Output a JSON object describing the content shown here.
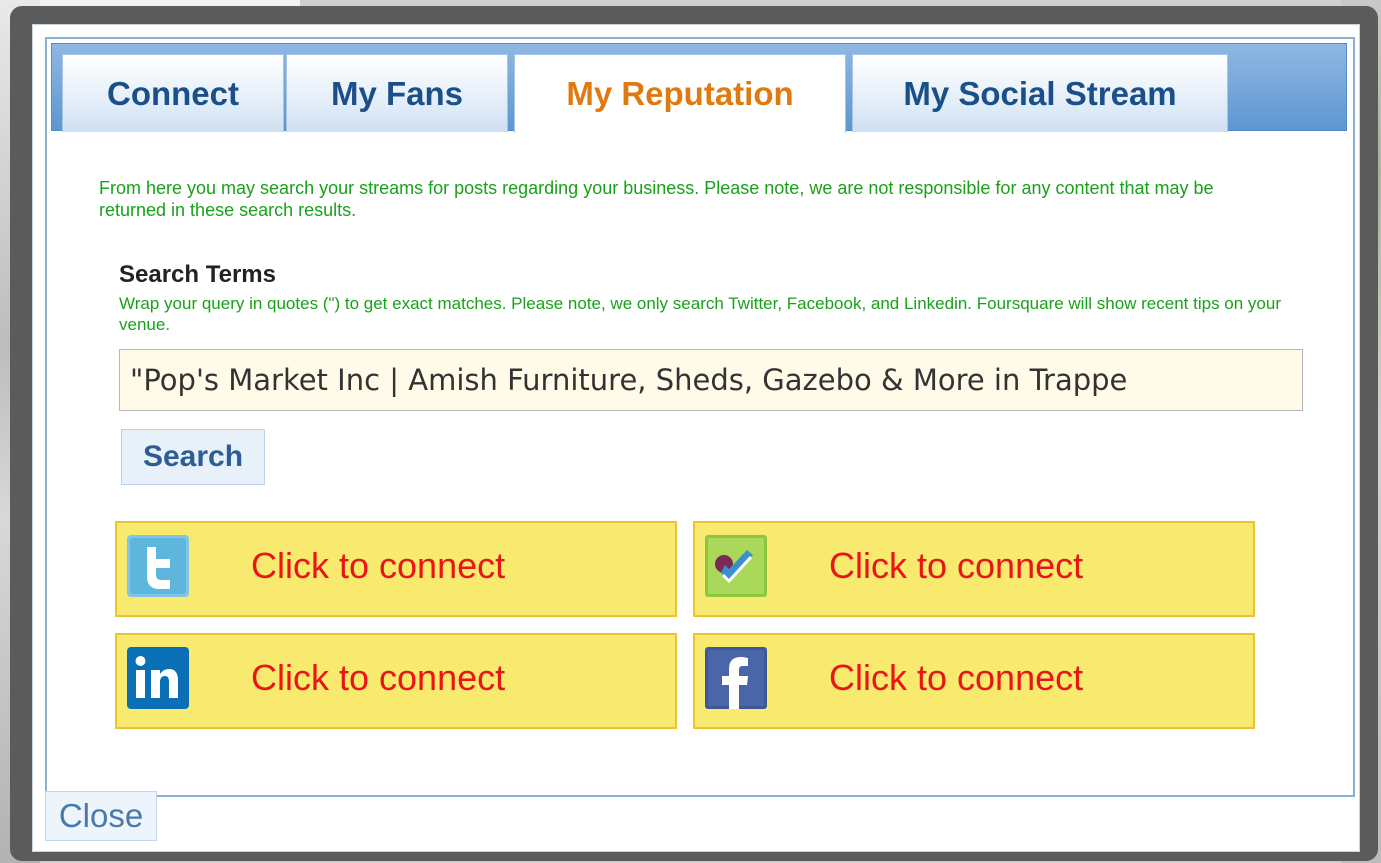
{
  "tabs": [
    {
      "label": "Connect",
      "active": false
    },
    {
      "label": "My Fans",
      "active": false
    },
    {
      "label": "My Reputation",
      "active": true
    },
    {
      "label": "My Social Stream",
      "active": false
    }
  ],
  "intro_text": "From here you may search your streams for posts regarding your business. Please note, we are not responsible for any content that may be returned in these search results.",
  "search": {
    "title": "Search Terms",
    "hint": "Wrap your query in quotes (\") to get exact matches. Please note, we only search Twitter, Facebook, and Linkedin. Foursquare will show recent tips on your venue.",
    "value": "\"Pop's Market Inc | Amish Furniture, Sheds, Gazebo & More in Trappe",
    "button_label": "Search"
  },
  "connect_buttons": [
    {
      "service": "twitter",
      "icon": "twitter-icon",
      "label": "Click to connect"
    },
    {
      "service": "foursquare",
      "icon": "foursquare-icon",
      "label": "Click to connect"
    },
    {
      "service": "linkedin",
      "icon": "linkedin-icon",
      "label": "Click to connect"
    },
    {
      "service": "facebook",
      "icon": "facebook-icon",
      "label": "Click to connect"
    }
  ],
  "close_label": "Close",
  "colors": {
    "active_tab": "#e07a10",
    "tab_text": "#1b4f8a",
    "notice_green": "#1aa11a",
    "connect_bg": "#f8ea6e",
    "connect_text": "#e81616"
  }
}
